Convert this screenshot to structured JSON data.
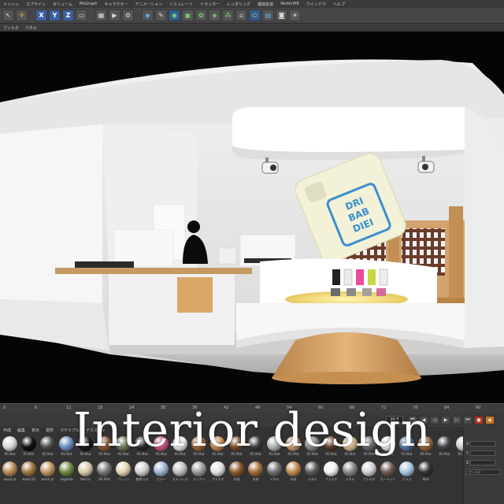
{
  "menu": {
    "items": [
      "メッシュ",
      "スプライン",
      "ボリューム",
      "MoGraph",
      "キャラクター",
      "アニメーション",
      "シミュレート",
      "トラッカー",
      "レンダリング",
      "機能拡張",
      "RedshiftR",
      "ウインドウ",
      "ヘルプ"
    ]
  },
  "toolbar": {
    "axis_x": "X",
    "axis_y": "Y",
    "axis_z": "Z"
  },
  "subbar": {
    "items": [
      "フィルタ",
      "パネル"
    ]
  },
  "phone_case": {
    "text_line1": "DRI",
    "text_line2": "BAB",
    "text_line3": "DIEI"
  },
  "timeline": {
    "ticks": [
      "0",
      "6",
      "12",
      "18",
      "24",
      "30",
      "36",
      "42",
      "48",
      "54",
      "60",
      "66",
      "72",
      "78",
      "84",
      "90"
    ],
    "frame": "90 F"
  },
  "materials": {
    "menu": [
      "作成",
      "編集",
      "表示",
      "選択",
      "マテリアル",
      "テクスチャ"
    ],
    "row1": [
      "RS Mat",
      "RS Mat",
      "RS Mat",
      "RS Mat",
      "RS Mat",
      "RS Mat",
      "RS Mat",
      "RS Mat",
      "RS Mat",
      "RS Mat",
      "RS Mat",
      "RS Mat",
      "RS Mat",
      "RS Mat",
      "RS Mat",
      "RS Mat",
      "RS Mat",
      "RS Mat",
      "RS Mat",
      "RS Mat",
      "RS Mat",
      "RS Mat",
      "RS Mat",
      "RS Mat",
      "RS Mat"
    ],
    "row2": [
      "wood pl",
      "wood 25",
      "wood pl",
      "vegetab",
      "ttes.tx",
      "RS Mat",
      "ブレッソ",
      "無骨ラス",
      "カラー",
      "ステンレス",
      "コンクリ",
      "プラスチ",
      "木材",
      "木材",
      "メタル",
      "木材",
      "メタル",
      "プラスチ",
      "メタル",
      "プラスチ",
      "カーペット",
      "ガラス",
      "Mat"
    ]
  },
  "attributes": {
    "labels": [
      "X",
      "Y",
      "Z"
    ],
    "dropdown": "ワールド"
  },
  "overlay": {
    "title": "Interior design"
  },
  "colors": {
    "accent": "#3b5fa3",
    "record": "#b8321f",
    "wood": "#c99a5e",
    "bg_dark": "#050505"
  }
}
